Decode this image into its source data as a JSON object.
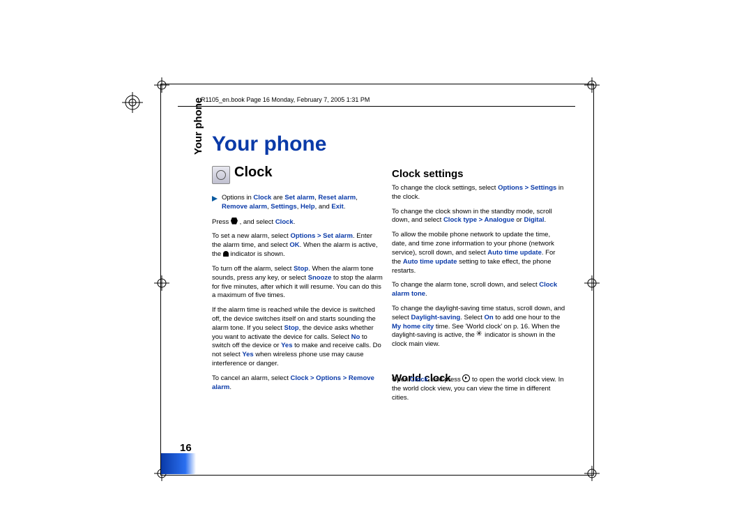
{
  "header": "R1105_en.book  Page 16  Monday, February 7, 2005  1:31 PM",
  "side_label": "Your phone",
  "page_number": "16",
  "chapter": "Your phone",
  "section_clock": "Clock",
  "section_settings": "Clock settings",
  "section_world": "World clock",
  "left": {
    "options_prefix": "Options in ",
    "options_clock": "Clock",
    "options_mid": " are ",
    "opt1": "Set alarm",
    "opt2": "Reset alarm",
    "opt3": "Remove alarm",
    "opt4": "Settings",
    "opt5": "Help",
    "opt6": "Exit",
    "and": ", and ",
    "press": "Press ",
    "press2": " , and select ",
    "press_clock": "Clock",
    "p2a": "To set a new alarm, select ",
    "p2b": "Options > Set alarm",
    "p2c": ". Enter the alarm time, and select ",
    "p2d": "OK",
    "p2e": ". When the alarm is active, the ",
    "p2f": " indicator is shown.",
    "p3a": "To turn off the alarm, select ",
    "p3b": "Stop",
    "p3c": ". When the alarm tone sounds, press any key, or select ",
    "p3d": "Snooze",
    "p3e": " to stop the alarm for five minutes, after which it will resume. You can do this a maximum of five times.",
    "p4a": "If the alarm time is reached while the device is switched off, the device switches itself on and starts sounding the alarm tone. If you select ",
    "p4b": "Stop",
    "p4c": ", the device asks whether you want to activate the device for calls. Select ",
    "p4d": "No",
    "p4e": " to switch off the device or ",
    "p4f": "Yes",
    "p4g": " to make and receive calls. Do not select ",
    "p4h": "Yes",
    "p4i": " when wireless phone use may cause interference or danger.",
    "p5a": "To cancel an alarm, select ",
    "p5b": "Clock > Options > Remove alarm",
    "p5c": "."
  },
  "right": {
    "r1a": "To change the clock settings, select ",
    "r1b": "Options > Settings",
    "r1c": " in the clock.",
    "r2a": "To change the clock shown in the standby mode, scroll down, and select ",
    "r2b": "Clock type > Analogue",
    "r2c": " or ",
    "r2d": "Digital",
    "r2e": ".",
    "r3a": "To allow the mobile phone network to update the time, date, and time zone information to your phone (network service), scroll down, and select ",
    "r3b": "Auto time update",
    "r3c": ". For the ",
    "r3d": "Auto time update",
    "r3e": " setting to take effect, the phone restarts.",
    "r4a": "To change the alarm tone, scroll down, and select ",
    "r4b": "Clock alarm tone",
    "r4c": ".",
    "r5a": "To change the daylight-saving time status, scroll down, and select ",
    "r5b": "Daylight-saving",
    "r5c": ". Select ",
    "r5d": "On",
    "r5e": " to add one hour to the ",
    "r5f": "My home city",
    "r5g": " time. See 'World clock' on p. 16. When the daylight-saving is active, the ",
    "r5h": " indicator is shown in the clock main view.",
    "w1a": "Open ",
    "w1b": "Clock",
    "w1c": ", and press ",
    "w1d": " to open the world clock view. In the world clock view, you can view the time in different cities."
  }
}
